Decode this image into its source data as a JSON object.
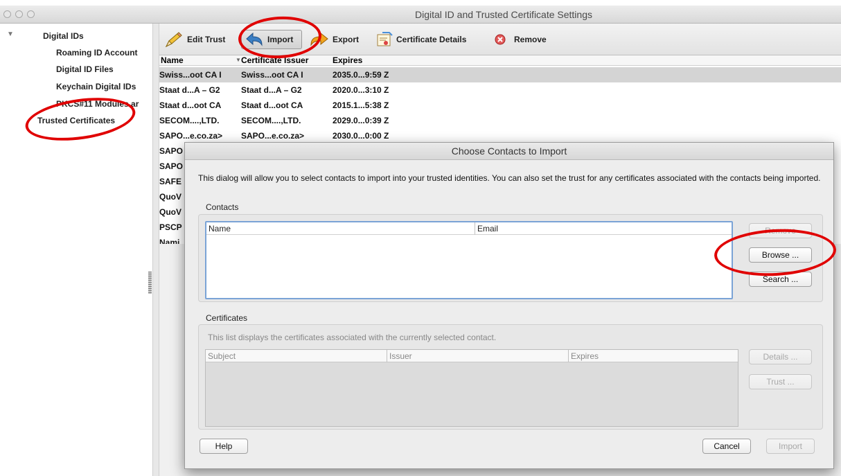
{
  "window": {
    "title": "Digital ID and Trusted Certificate Settings"
  },
  "sidebar": {
    "items": [
      {
        "label": "Digital IDs"
      },
      {
        "label": "Roaming ID Account"
      },
      {
        "label": "Digital ID Files"
      },
      {
        "label": "Keychain Digital IDs"
      },
      {
        "label": "PKCS#11 Modules ar"
      },
      {
        "label": "Trusted Certificates"
      }
    ]
  },
  "toolbar": {
    "edit_trust": "Edit Trust",
    "import": "Import",
    "export": "Export",
    "certificate_details": "Certificate Details",
    "remove": "Remove"
  },
  "cert_list": {
    "columns": [
      "Name",
      "Certificate Issuer",
      "Expires"
    ],
    "rows": [
      [
        "Swiss...oot CA I",
        "Swiss...oot CA I",
        "2035.0...9:59 Z"
      ],
      [
        "Staat d...A – G2",
        "Staat d...A – G2",
        "2020.0...3:10 Z"
      ],
      [
        "Staat d...oot CA",
        "Staat d...oot CA",
        "2015.1...5:38 Z"
      ],
      [
        "SECOM....,LTD.",
        "SECOM....,LTD.",
        "2029.0...0:39 Z"
      ],
      [
        "SAPO...e.co.za>",
        "SAPO...e.co.za>",
        "2030.0...0:00 Z"
      ],
      [
        "SAPO",
        "",
        ""
      ],
      [
        "SAPO",
        "",
        ""
      ],
      [
        "SAFE",
        "",
        ""
      ],
      [
        "QuoV",
        "",
        ""
      ],
      [
        "QuoV",
        "",
        ""
      ],
      [
        "PSCP",
        "",
        ""
      ],
      [
        "Nami",
        "",
        ""
      ]
    ]
  },
  "dialog": {
    "title": "Choose Contacts to Import",
    "description": "This dialog will allow you to select contacts to import into your trusted identities. You can also set the trust for any certificates associated with the contacts being imported.",
    "contacts": {
      "label": "Contacts",
      "columns": [
        "Name",
        "Email"
      ],
      "buttons": {
        "remove": "Remove",
        "browse": "Browse ...",
        "search": "Search ..."
      }
    },
    "certificates": {
      "label": "Certificates",
      "description": "This list displays the certificates associated with the currently selected contact.",
      "columns": [
        "Subject",
        "Issuer",
        "Expires"
      ],
      "buttons": {
        "details": "Details ...",
        "trust": "Trust ..."
      }
    },
    "footer": {
      "help": "Help",
      "cancel": "Cancel",
      "import": "Import"
    }
  }
}
